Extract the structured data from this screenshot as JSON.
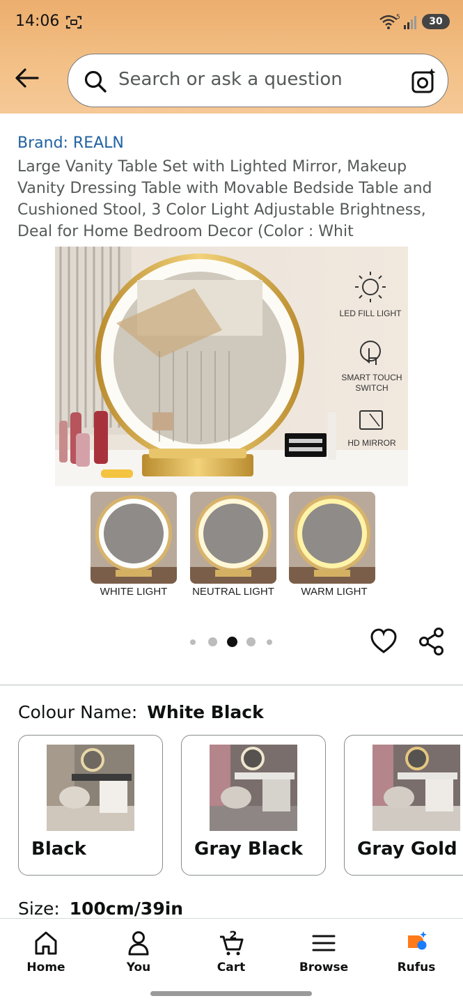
{
  "status_bar": {
    "time": "14:06",
    "battery": "30"
  },
  "search": {
    "placeholder": "Search or ask a question"
  },
  "product": {
    "brand": "Brand: REALN",
    "title": "Large Vanity Table Set with Lighted Mirror, Makeup Vanity Dressing Table with Movable Bedside Table and Cushioned Stool, 3 Color Light Adjustable Brightness, Deal for Home Bedroom Decor (Color : Whit",
    "features": [
      "LED FILL LIGHT",
      "SMART TOUCH SWITCH",
      "HD MIRROR"
    ],
    "light_modes": [
      "WHITE LIGHT",
      "NEUTRAL LIGHT",
      "WARM LIGHT"
    ],
    "image_dots": {
      "count": 5,
      "active_index": 2
    }
  },
  "colour": {
    "label": "Colour Name:",
    "selected": "White Black",
    "options": [
      "Black",
      "Gray Black",
      "Gray Gold"
    ]
  },
  "size": {
    "label": "Size:",
    "selected": "100cm/39in"
  },
  "bottom_nav": [
    {
      "label": "Home",
      "icon": "home-icon"
    },
    {
      "label": "You",
      "icon": "person-icon"
    },
    {
      "label": "Cart",
      "icon": "cart-icon",
      "badge": "2"
    },
    {
      "label": "Browse",
      "icon": "menu-icon"
    },
    {
      "label": "Rufus",
      "icon": "rufus-icon"
    }
  ],
  "colors": {
    "brand_link": "#2162a1",
    "header": "#f3c188",
    "rufus_orange": "#ff7a1a",
    "rufus_blue": "#1a7cff"
  }
}
